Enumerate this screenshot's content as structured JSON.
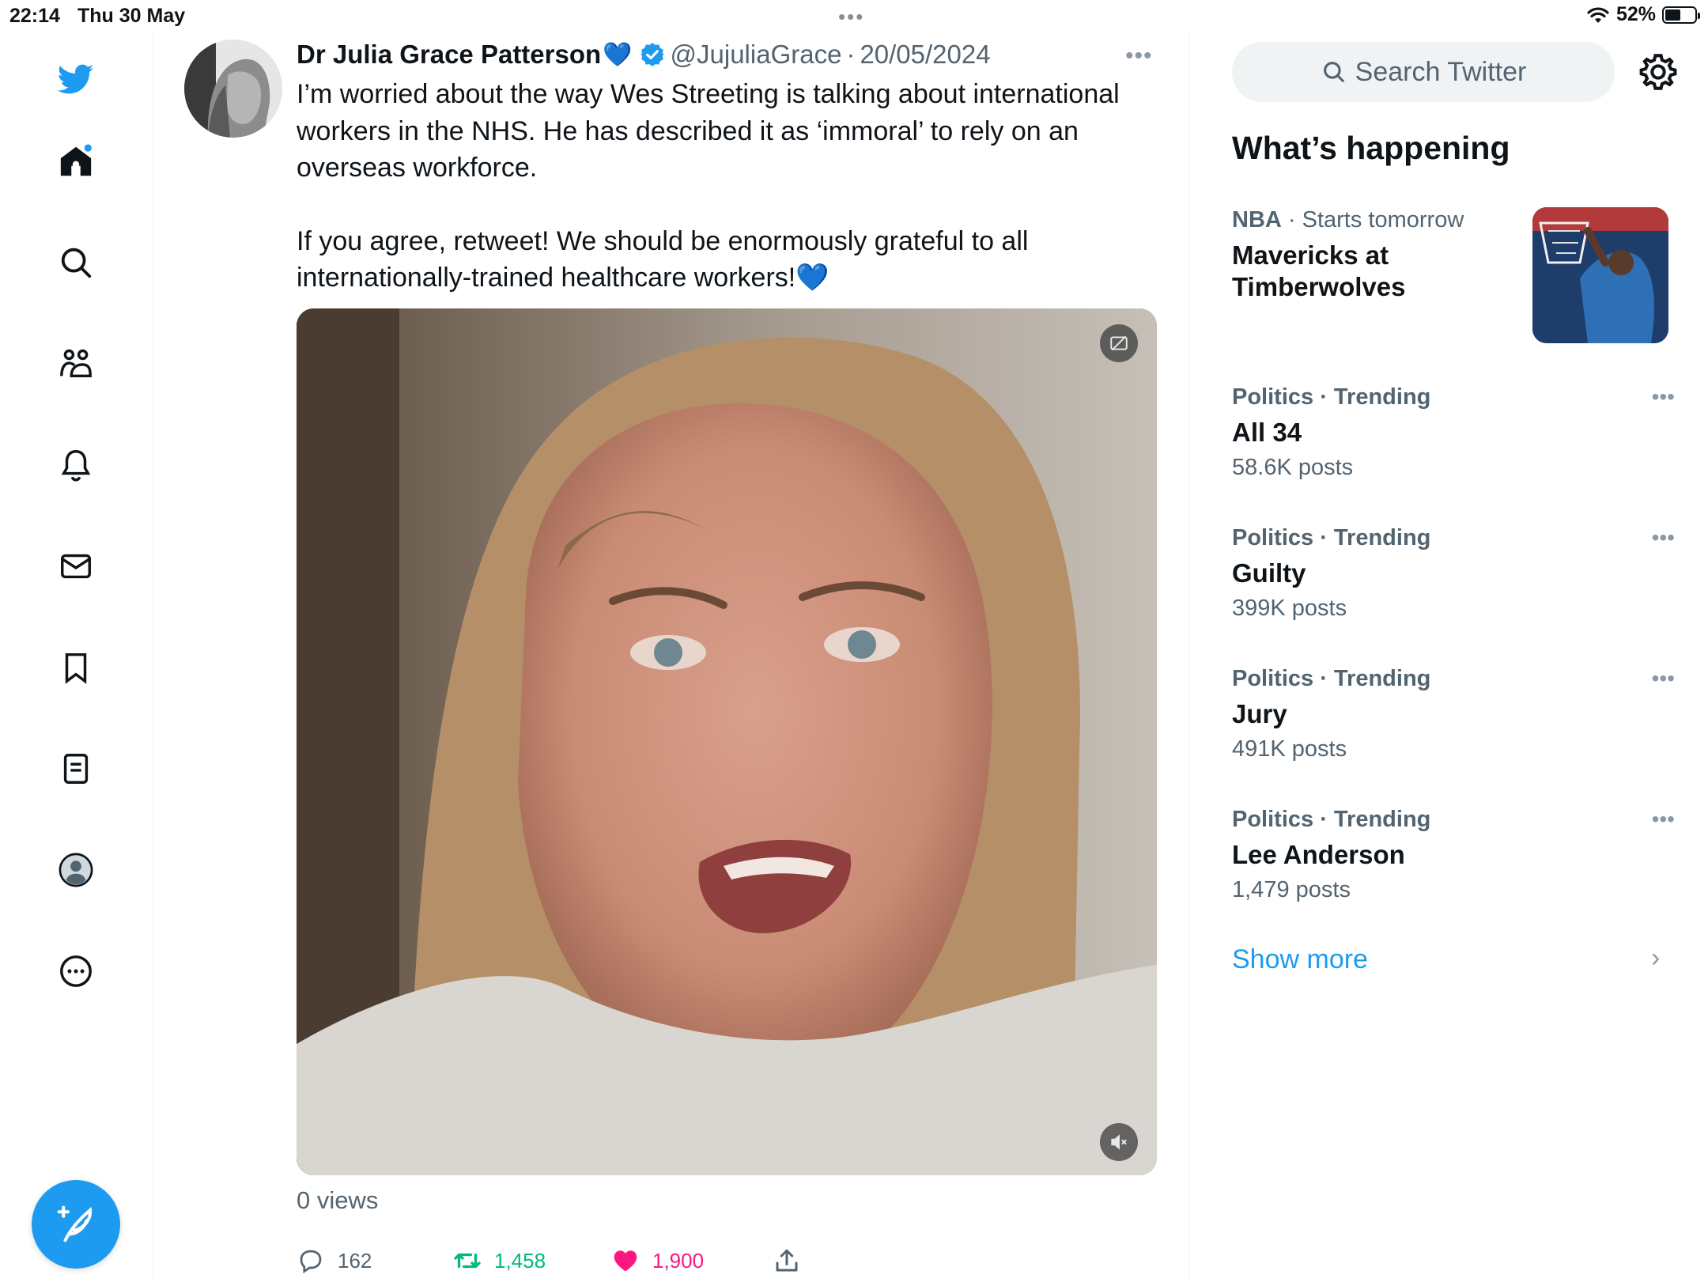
{
  "status_bar": {
    "time": "22:14",
    "date": "Thu 30 May",
    "battery_percent": "52%",
    "battery_level": 0.52
  },
  "nav": {
    "items": [
      "twitter-logo",
      "home",
      "explore",
      "communities",
      "notifications",
      "messages",
      "bookmarks",
      "lists",
      "profile",
      "more"
    ],
    "accent_color": "#1d9bf0"
  },
  "tweet": {
    "author_name": "Dr Julia Grace Patterson",
    "name_emoji": "💙",
    "handle": "@JujuliaGrace",
    "separator": "·",
    "date": "20/05/2024",
    "paragraph_1": "I’m worried about the way Wes Streeting is talking about international workers in the NHS. He has described it as ‘immoral’  to rely on an overseas workforce.",
    "paragraph_2": "If you agree, retweet! We should be enormously grateful to all internationally-trained healthcare workers!",
    "paragraph_2_emoji": "💙",
    "views": "0 views",
    "replies": "162",
    "retweets": "1,458",
    "likes": "1,900",
    "retweet_color": "#00ba7c",
    "like_color": "#f91880"
  },
  "sidebar": {
    "search_placeholder": "Search Twitter",
    "section_title": "What’s happening",
    "trends": [
      {
        "category": "NBA",
        "context": "· Starts tomorrow",
        "topic": "Mavericks at Timberwolves",
        "count": ""
      },
      {
        "category": "Politics",
        "context": "· Trending",
        "topic": "All 34",
        "count": "58.6K posts"
      },
      {
        "category": "Politics",
        "context": "· Trending",
        "topic": "Guilty",
        "count": "399K posts"
      },
      {
        "category": "Politics",
        "context": "· Trending",
        "topic": "Jury",
        "count": "491K posts"
      },
      {
        "category": "Politics",
        "context": "· Trending",
        "topic": "Lee Anderson",
        "count": "1,479 posts"
      }
    ],
    "show_more": "Show more",
    "link_color": "#1d9bf0"
  }
}
